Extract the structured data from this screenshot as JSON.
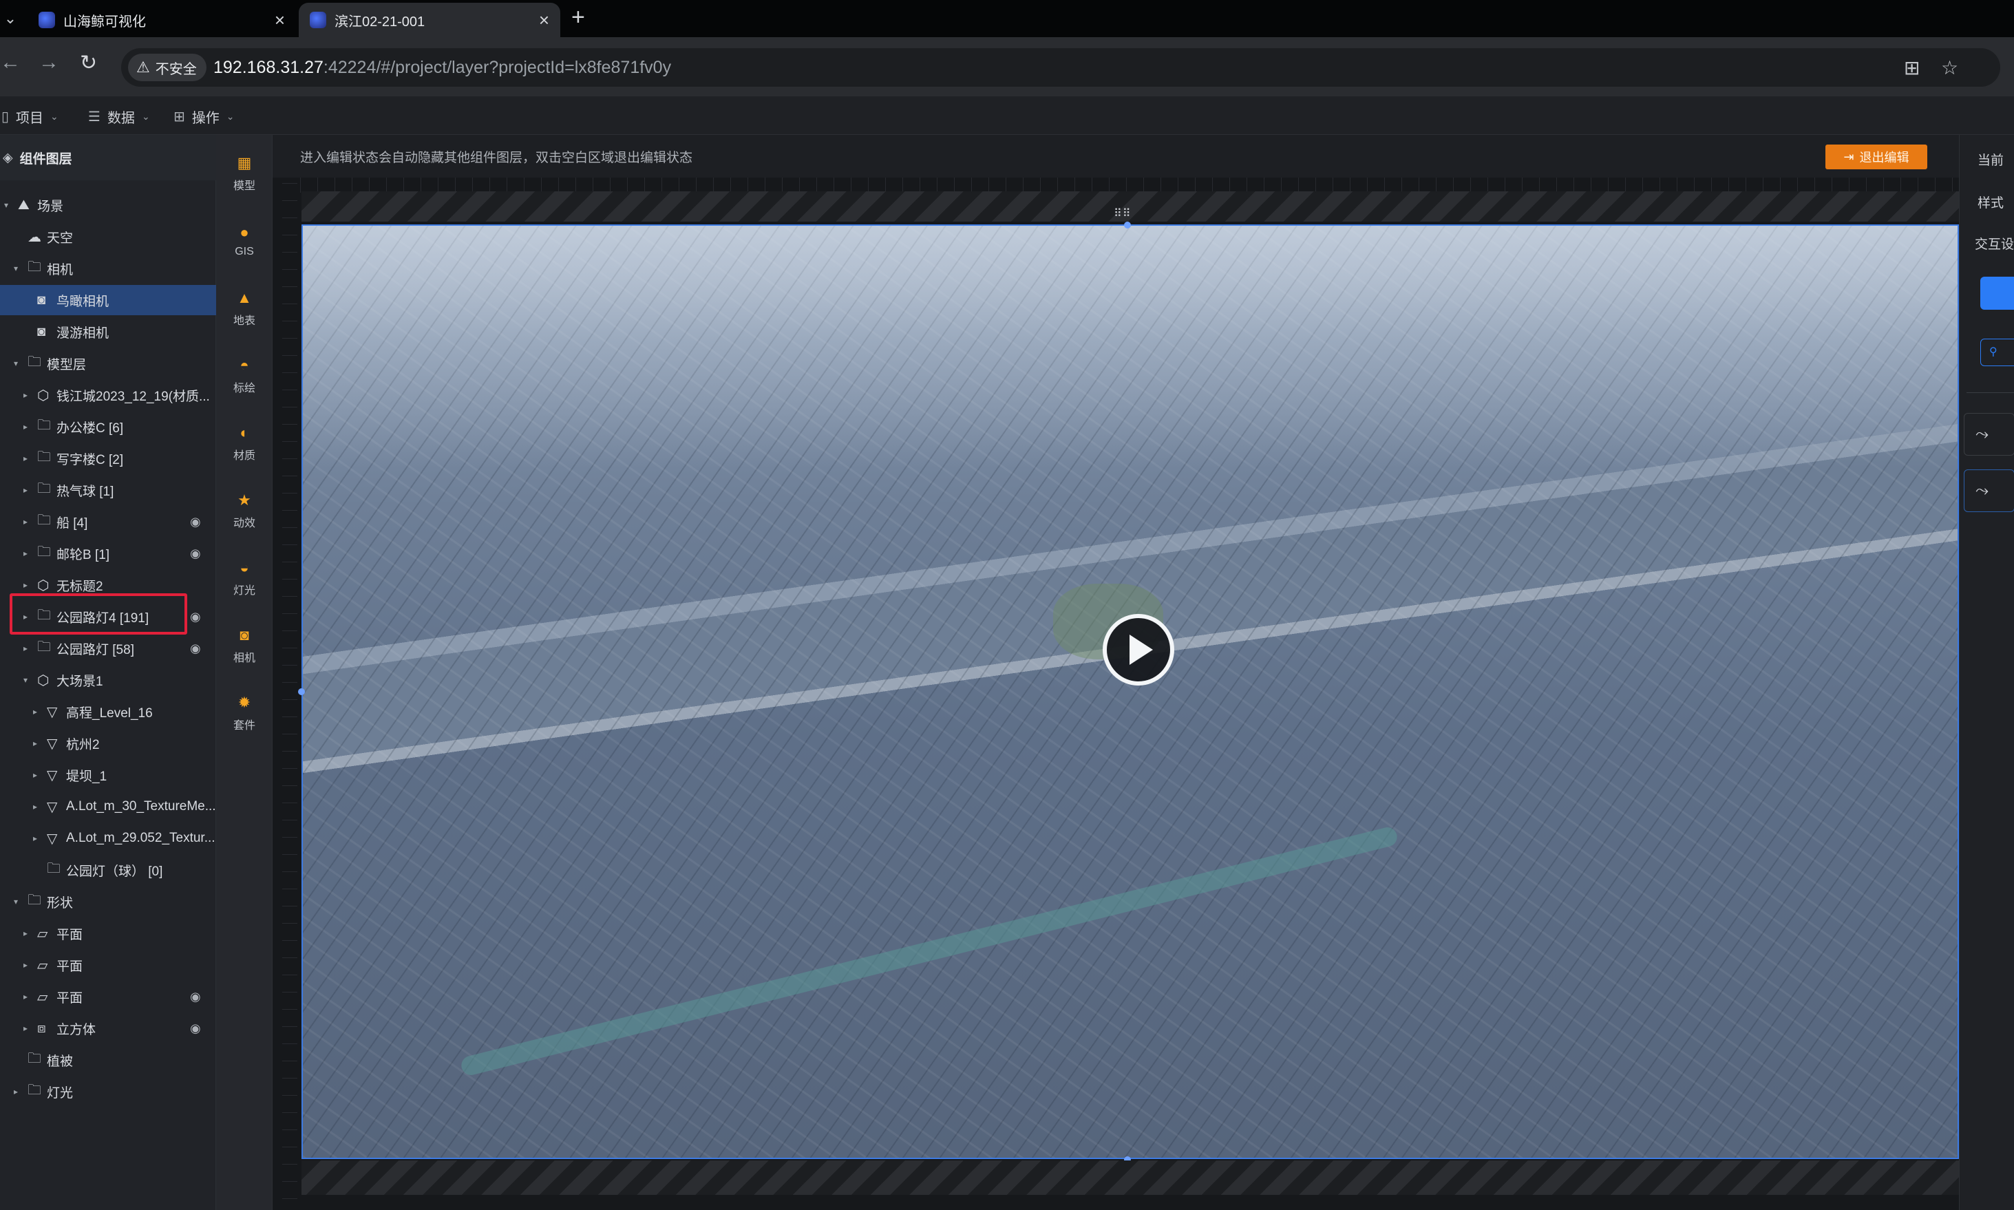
{
  "browser": {
    "menu_icon": "chevron-down-icon",
    "tabs": [
      {
        "title": "山海鲸可视化",
        "close": "×"
      },
      {
        "title": "滨江02-21-001",
        "close": "×"
      }
    ],
    "new_tab": "+",
    "security_label": "不安全",
    "url_host": "192.168.31.27",
    "url_rest": ":42224/#/project/layer?projectId=lx8fe871fv0y"
  },
  "app_menu": {
    "project": "项目",
    "data": "数据",
    "operations": "操作"
  },
  "layer_panel": {
    "title": "组件图层",
    "items": [
      {
        "label": "场景",
        "icon": "scene-icon",
        "depth": 0,
        "arrow": "▾"
      },
      {
        "label": "天空",
        "icon": "sky-icon",
        "depth": 1,
        "arrow": ""
      },
      {
        "label": "相机",
        "icon": "folder-icon",
        "depth": 1,
        "arrow": "▾"
      },
      {
        "label": "鸟瞰相机",
        "icon": "camera-icon",
        "depth": 2,
        "arrow": "",
        "selected": true
      },
      {
        "label": "漫游相机",
        "icon": "camera-icon",
        "depth": 2,
        "arrow": ""
      },
      {
        "label": "模型层",
        "icon": "folder-icon",
        "depth": 1,
        "arrow": "▾"
      },
      {
        "label": "钱江城2023_12_19(材质...",
        "icon": "model-icon",
        "depth": 2,
        "arrow": "▸"
      },
      {
        "label": "办公楼C [6]",
        "icon": "folder-icon",
        "depth": 2,
        "arrow": "▸"
      },
      {
        "label": "写字楼C [2]",
        "icon": "folder-icon",
        "depth": 2,
        "arrow": "▸"
      },
      {
        "label": "热气球 [1]",
        "icon": "folder-icon",
        "depth": 2,
        "arrow": "▸"
      },
      {
        "label": "船 [4]",
        "icon": "folder-icon",
        "depth": 2,
        "arrow": "▸",
        "hidden": true
      },
      {
        "label": "邮轮B [1]",
        "icon": "folder-icon",
        "depth": 2,
        "arrow": "▸",
        "hidden": true
      },
      {
        "label": "无标题2",
        "icon": "model-icon",
        "depth": 2,
        "arrow": "▸"
      },
      {
        "label": "公园路灯4 [191]",
        "icon": "folder-icon",
        "depth": 2,
        "arrow": "▸",
        "hidden": true
      },
      {
        "label": "公园路灯 [58]",
        "icon": "folder-icon",
        "depth": 2,
        "arrow": "▸",
        "hidden": true
      },
      {
        "label": "大场景1",
        "icon": "model-icon",
        "depth": 2,
        "arrow": "▾"
      },
      {
        "label": "高程_Level_16",
        "icon": "triangle-icon",
        "depth": 3,
        "arrow": "▸"
      },
      {
        "label": "杭州2",
        "icon": "triangle-icon",
        "depth": 3,
        "arrow": "▸"
      },
      {
        "label": "堤坝_1",
        "icon": "triangle-icon",
        "depth": 3,
        "arrow": "▸"
      },
      {
        "label": "A.Lot_m_30_TextureMe...",
        "icon": "triangle-icon",
        "depth": 3,
        "arrow": "▸"
      },
      {
        "label": "A.Lot_m_29.052_Textur...",
        "icon": "triangle-icon",
        "depth": 3,
        "arrow": "▸"
      },
      {
        "label": "公园灯（球） [0]",
        "icon": "folder-icon",
        "depth": 3,
        "arrow": ""
      },
      {
        "label": "形状",
        "icon": "folder-icon",
        "depth": 1,
        "arrow": "▾"
      },
      {
        "label": "平面",
        "icon": "plane-icon",
        "depth": 2,
        "arrow": "▸"
      },
      {
        "label": "平面",
        "icon": "plane-icon",
        "depth": 2,
        "arrow": "▸"
      },
      {
        "label": "平面",
        "icon": "plane-icon",
        "depth": 2,
        "arrow": "▸",
        "hidden": true
      },
      {
        "label": "立方体",
        "icon": "cube-icon",
        "depth": 2,
        "arrow": "▸",
        "hidden": true
      },
      {
        "label": "植被",
        "icon": "folder-icon",
        "depth": 1,
        "arrow": ""
      },
      {
        "label": "灯光",
        "icon": "folder-icon",
        "depth": 1,
        "arrow": "▸"
      }
    ]
  },
  "component_strip": [
    {
      "label": "模型",
      "icon": "model-box-icon"
    },
    {
      "label": "GIS",
      "icon": "globe-icon"
    },
    {
      "label": "地表",
      "icon": "terrain-icon"
    },
    {
      "label": "标绘",
      "icon": "marker-icon"
    },
    {
      "label": "材质",
      "icon": "material-icon"
    },
    {
      "label": "动效",
      "icon": "star-icon"
    },
    {
      "label": "灯光",
      "icon": "light-icon"
    },
    {
      "label": "相机",
      "icon": "camera-icon"
    },
    {
      "label": "套件",
      "icon": "kit-icon"
    }
  ],
  "canvas": {
    "tip": "进入编辑状态会自动隐藏其他组件图层，双击空白区域退出编辑状态",
    "exit_edit": "退出编辑",
    "grip": "⠿⠿"
  },
  "props_panel": {
    "current": "当前",
    "style_tab": "样式",
    "interaction_tab": "交互设"
  },
  "colors": {
    "accent_blue": "#2b7cf6",
    "exit_orange": "#e87a14",
    "highlight_red": "#e2203a",
    "selected_row": "#27467a"
  }
}
